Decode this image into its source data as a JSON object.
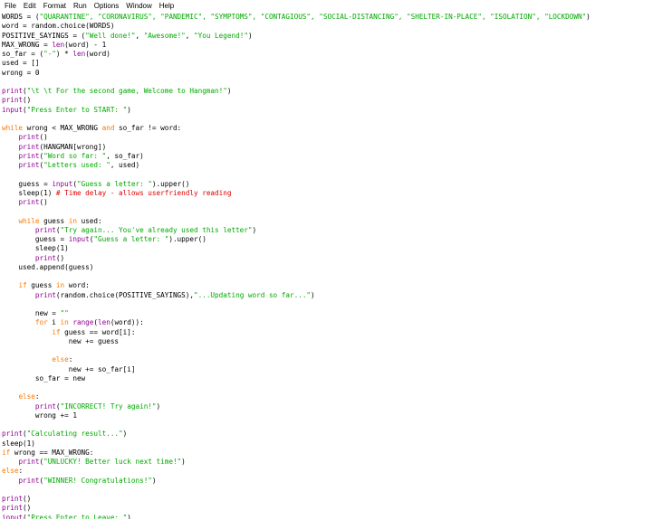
{
  "menu": [
    "File",
    "Edit",
    "Format",
    "Run",
    "Options",
    "Window",
    "Help"
  ],
  "colors": {
    "keyword": "#ff7700",
    "builtin": "#900090",
    "string": "#00aa00",
    "comment": "#dd0000",
    "default": "#000000",
    "background": "#ffffff"
  },
  "lines": [
    [
      [
        "WORDS = (",
        ""
      ],
      [
        "\"QUARANTINE\", \"CORONAVIRUS\", \"PANDEMIC\", \"SYMPTOMS\", \"CONTAGIOUS\", \"SOCIAL-DISTANCING\", \"SHELTER-IN-PLACE\", \"ISOLATION\", \"LOCKDOWN\"",
        "st"
      ],
      [
        ")",
        ""
      ]
    ],
    [
      [
        "word = random.choice(WORDS)",
        ""
      ]
    ],
    [
      [
        "POSITIVE_SAYINGS = (",
        ""
      ],
      [
        "\"Well done!\"",
        "st"
      ],
      [
        ", ",
        ""
      ],
      [
        "\"Awesome!\"",
        "st"
      ],
      [
        ", ",
        ""
      ],
      [
        "\"You Legend!\"",
        "st"
      ],
      [
        ")",
        ""
      ]
    ],
    [
      [
        "MAX_WRONG = ",
        ""
      ],
      [
        "len",
        "bi"
      ],
      [
        "(word) - 1",
        ""
      ]
    ],
    [
      [
        "so_far = (",
        ""
      ],
      [
        "\"-\"",
        "st"
      ],
      [
        ") * ",
        ""
      ],
      [
        "len",
        "bi"
      ],
      [
        "(word)",
        ""
      ]
    ],
    [
      [
        "used = []",
        ""
      ]
    ],
    [
      [
        "wrong = 0",
        ""
      ]
    ],
    [
      [
        "",
        ""
      ]
    ],
    [
      [
        "print",
        "bi"
      ],
      [
        "(",
        ""
      ],
      [
        "\"\\t \\t For the second game, Welcome to Hangman!\"",
        "st"
      ],
      [
        ")",
        ""
      ]
    ],
    [
      [
        "print",
        "bi"
      ],
      [
        "()",
        ""
      ]
    ],
    [
      [
        "input",
        "bi"
      ],
      [
        "(",
        ""
      ],
      [
        "\"Press Enter to START: \"",
        "st"
      ],
      [
        ")",
        ""
      ]
    ],
    [
      [
        "",
        ""
      ]
    ],
    [
      [
        "while",
        "kw"
      ],
      [
        " wrong < MAX_WRONG ",
        ""
      ],
      [
        "and",
        "kw"
      ],
      [
        " so_far != word:",
        ""
      ]
    ],
    [
      [
        "    ",
        ""
      ],
      [
        "print",
        "bi"
      ],
      [
        "()",
        ""
      ]
    ],
    [
      [
        "    ",
        ""
      ],
      [
        "print",
        "bi"
      ],
      [
        "(HANGMAN[wrong])",
        ""
      ]
    ],
    [
      [
        "    ",
        ""
      ],
      [
        "print",
        "bi"
      ],
      [
        "(",
        ""
      ],
      [
        "\"Word so far: \"",
        "st"
      ],
      [
        ", so_far)",
        ""
      ]
    ],
    [
      [
        "    ",
        ""
      ],
      [
        "print",
        "bi"
      ],
      [
        "(",
        ""
      ],
      [
        "\"Letters used: \"",
        "st"
      ],
      [
        ", used)",
        ""
      ]
    ],
    [
      [
        "",
        ""
      ]
    ],
    [
      [
        "    guess = ",
        ""
      ],
      [
        "input",
        "bi"
      ],
      [
        "(",
        ""
      ],
      [
        "\"Guess a letter: \"",
        "st"
      ],
      [
        ").upper()",
        ""
      ]
    ],
    [
      [
        "    sleep(1) ",
        ""
      ],
      [
        "# Time delay - allows userfriendly reading",
        "cm"
      ]
    ],
    [
      [
        "    ",
        ""
      ],
      [
        "print",
        "bi"
      ],
      [
        "()",
        ""
      ]
    ],
    [
      [
        "",
        ""
      ]
    ],
    [
      [
        "    ",
        ""
      ],
      [
        "while",
        "kw"
      ],
      [
        " guess ",
        ""
      ],
      [
        "in",
        "kw"
      ],
      [
        " used:",
        ""
      ]
    ],
    [
      [
        "        ",
        ""
      ],
      [
        "print",
        "bi"
      ],
      [
        "(",
        ""
      ],
      [
        "\"Try again... You've already used this letter\"",
        "st"
      ],
      [
        ")",
        ""
      ]
    ],
    [
      [
        "        guess = ",
        ""
      ],
      [
        "input",
        "bi"
      ],
      [
        "(",
        ""
      ],
      [
        "\"Guess a letter: \"",
        "st"
      ],
      [
        ").upper()",
        ""
      ]
    ],
    [
      [
        "        sleep(1)",
        ""
      ]
    ],
    [
      [
        "        ",
        ""
      ],
      [
        "print",
        "bi"
      ],
      [
        "()",
        ""
      ]
    ],
    [
      [
        "    used.append(guess)",
        ""
      ]
    ],
    [
      [
        "",
        ""
      ]
    ],
    [
      [
        "    ",
        ""
      ],
      [
        "if",
        "kw"
      ],
      [
        " guess ",
        ""
      ],
      [
        "in",
        "kw"
      ],
      [
        " word:",
        ""
      ]
    ],
    [
      [
        "        ",
        ""
      ],
      [
        "print",
        "bi"
      ],
      [
        "(random.choice(POSITIVE_SAYINGS),",
        ""
      ],
      [
        "\"...Updating word so far...\"",
        "st"
      ],
      [
        ")",
        ""
      ]
    ],
    [
      [
        "",
        ""
      ]
    ],
    [
      [
        "        new = ",
        ""
      ],
      [
        "\"\"",
        "st"
      ]
    ],
    [
      [
        "        ",
        ""
      ],
      [
        "for",
        "kw"
      ],
      [
        " i ",
        ""
      ],
      [
        "in",
        "kw"
      ],
      [
        " ",
        ""
      ],
      [
        "range",
        "bi"
      ],
      [
        "(",
        ""
      ],
      [
        "len",
        "bi"
      ],
      [
        "(word)):",
        ""
      ]
    ],
    [
      [
        "            ",
        ""
      ],
      [
        "if",
        "kw"
      ],
      [
        " guess == word[i]:",
        ""
      ]
    ],
    [
      [
        "                new += guess",
        ""
      ]
    ],
    [
      [
        "",
        ""
      ]
    ],
    [
      [
        "            ",
        ""
      ],
      [
        "else",
        "kw"
      ],
      [
        ":",
        ""
      ]
    ],
    [
      [
        "                new += so_far[i]",
        ""
      ]
    ],
    [
      [
        "        so_far = new",
        ""
      ]
    ],
    [
      [
        "",
        ""
      ]
    ],
    [
      [
        "    ",
        ""
      ],
      [
        "else",
        "kw"
      ],
      [
        ":",
        ""
      ]
    ],
    [
      [
        "        ",
        ""
      ],
      [
        "print",
        "bi"
      ],
      [
        "(",
        ""
      ],
      [
        "\"INCORRECT! Try again!\"",
        "st"
      ],
      [
        ")",
        ""
      ]
    ],
    [
      [
        "        wrong += 1",
        ""
      ]
    ],
    [
      [
        "",
        ""
      ]
    ],
    [
      [
        "print",
        "bi"
      ],
      [
        "(",
        ""
      ],
      [
        "\"Calculating result...\"",
        "st"
      ],
      [
        ")",
        ""
      ]
    ],
    [
      [
        "sleep(1)",
        ""
      ]
    ],
    [
      [
        "if",
        "kw"
      ],
      [
        " wrong == MAX_WRONG:",
        ""
      ]
    ],
    [
      [
        "    ",
        ""
      ],
      [
        "print",
        "bi"
      ],
      [
        "(",
        ""
      ],
      [
        "\"UNLUCKY! Better luck next time!\"",
        "st"
      ],
      [
        ")",
        ""
      ]
    ],
    [
      [
        "else",
        "kw"
      ],
      [
        ":",
        ""
      ]
    ],
    [
      [
        "    ",
        ""
      ],
      [
        "print",
        "bi"
      ],
      [
        "(",
        ""
      ],
      [
        "\"WINNER! Congratulations!\"",
        "st"
      ],
      [
        ")",
        ""
      ]
    ],
    [
      [
        "",
        ""
      ]
    ],
    [
      [
        "print",
        "bi"
      ],
      [
        "()",
        ""
      ]
    ],
    [
      [
        "print",
        "bi"
      ],
      [
        "()",
        ""
      ]
    ],
    [
      [
        "input",
        "bi"
      ],
      [
        "(",
        ""
      ],
      [
        "\"Press Enter to Leave: \"",
        "st"
      ],
      [
        ")",
        ""
      ]
    ]
  ]
}
